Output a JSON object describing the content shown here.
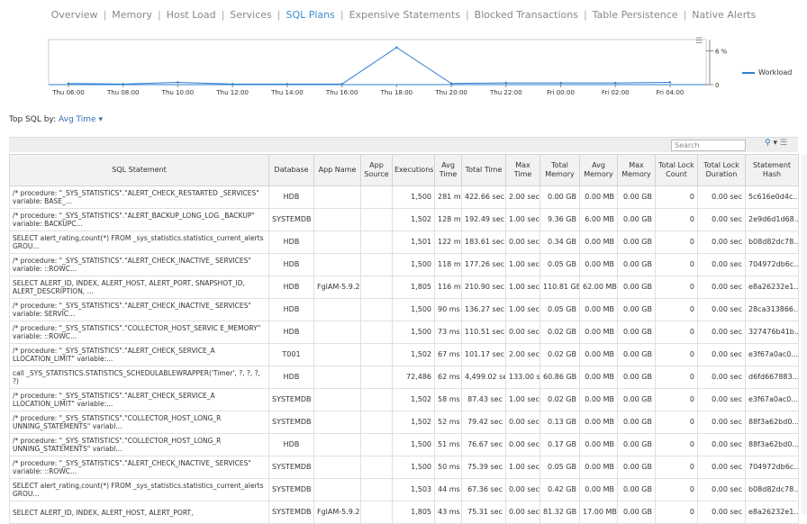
{
  "nav": {
    "tabs": [
      "Overview",
      "Memory",
      "Host Load",
      "Services",
      "SQL Plans",
      "Expensive Statements",
      "Blocked Transactions",
      "Table Persistence",
      "Native Alerts"
    ],
    "active": "SQL Plans"
  },
  "chart_data": {
    "type": "line",
    "x": [
      "Thu 06:00",
      "Thu 08:00",
      "Thu 10:00",
      "Thu 12:00",
      "Thu 14:00",
      "Thu 16:00",
      "Thu 18:00",
      "Thu 20:00",
      "Thu 22:00",
      "Fri 00:00",
      "Fri 02:00",
      "Fri 04:00"
    ],
    "series": [
      {
        "name": "Workload",
        "values": [
          0.2,
          0.1,
          0.4,
          0.1,
          0.1,
          0.1,
          6.6,
          0.2,
          0.3,
          0.3,
          0.3,
          0.4
        ]
      }
    ],
    "y_tick_labels": [
      "0",
      "6 %"
    ],
    "ylim": [
      0,
      8
    ]
  },
  "legend": {
    "label": "Workload",
    "color": "#2f7fd0"
  },
  "topsql": {
    "label": "Top SQL by:",
    "value": "Avg Time"
  },
  "search": {
    "placeholder": "Search"
  },
  "columns": [
    "SQL Statement",
    "Database",
    "App Name",
    "App Source",
    "Executions",
    "Avg Time",
    "Total Time",
    "Max Time",
    "Total Memory",
    "Avg Memory",
    "Max Memory",
    "Total Lock Count",
    "Total Lock Duration",
    "Statement Hash"
  ],
  "rows": [
    [
      "/* procedure: \"_SYS_STATISTICS\".\"ALERT_CHECK_RESTARTED _SERVICES\" variable: BASE_...",
      "HDB",
      "",
      "",
      "1,500",
      "281 ms",
      "422.66 sec",
      "2.00 sec",
      "0.00 GB",
      "0.00 MB",
      "0.00 GB",
      "0",
      "0.00 sec",
      "5c616e0d4c..."
    ],
    [
      "/* procedure: \"_SYS_STATISTICS\".\"ALERT_BACKUP_LONG_LOG _BACKUP\" variable: BACKUPC...",
      "SYSTEMDB",
      "",
      "",
      "1,502",
      "128 ms",
      "192.49 sec",
      "1.00 sec",
      "9.36 GB",
      "6.00 MB",
      "0.00 GB",
      "0",
      "0.00 sec",
      "2e9d6d1d68..."
    ],
    [
      "SELECT alert_rating,count(*) FROM _sys_statistics.statistics_current_alerts GROU...",
      "HDB",
      "",
      "",
      "1,501",
      "122 ms",
      "183.61 sec",
      "0.00 sec",
      "0.34 GB",
      "0.00 MB",
      "0.00 GB",
      "0",
      "0.00 sec",
      "b08d82dc78..."
    ],
    [
      "/* procedure: \"_SYS_STATISTICS\".\"ALERT_CHECK_INACTIVE_ SERVICES\" variable: ::ROWC...",
      "HDB",
      "",
      "",
      "1,500",
      "118 ms",
      "177.26 sec",
      "1.00 sec",
      "0.05 GB",
      "0.00 MB",
      "0.00 GB",
      "0",
      "0.00 sec",
      "704972db6c..."
    ],
    [
      "SELECT ALERT_ID, INDEX, ALERT_HOST, ALERT_PORT, SNAPSHOT_ID, ALERT_DESCRIPTION, ...",
      "HDB",
      "FglAM-5.9.2",
      "",
      "1,805",
      "116 ms",
      "210.90 sec",
      "1.00 sec",
      "110.81 GB",
      "62.00 MB",
      "0.00 GB",
      "0",
      "0.00 sec",
      "e8a26232e1..."
    ],
    [
      "/* procedure: \"_SYS_STATISTICS\".\"ALERT_CHECK_INACTIVE_ SERVICES\" variable: SERVIC...",
      "HDB",
      "",
      "",
      "1,500",
      "90 ms",
      "136.27 sec",
      "1.00 sec",
      "0.05 GB",
      "0.00 MB",
      "0.00 GB",
      "0",
      "0.00 sec",
      "28ca313866..."
    ],
    [
      "/* procedure: \"_SYS_STATISTICS\".\"COLLECTOR_HOST_SERVIC E_MEMORY\" variable: ::ROWC...",
      "HDB",
      "",
      "",
      "1,500",
      "73 ms",
      "110.51 sec",
      "0.00 sec",
      "0.02 GB",
      "0.00 MB",
      "0.00 GB",
      "0",
      "0.00 sec",
      "327476b41b..."
    ],
    [
      "/* procedure: \"_SYS_STATISTICS\".\"ALERT_CHECK_SERVICE_A LLOCATION_LIMIT\" variable:...",
      "T001",
      "",
      "",
      "1,502",
      "67 ms",
      "101.17 sec",
      "2.00 sec",
      "0.02 GB",
      "0.00 MB",
      "0.00 GB",
      "0",
      "0.00 sec",
      "e3f67a0ac0..."
    ],
    [
      "call _SYS_STATISTICS.STATISTICS_SCHEDULABLEWRAPPER('Timer', ?, ?, ?, ?)",
      "HDB",
      "",
      "",
      "72,486",
      "62 ms",
      "4,499.02 sec",
      "133.00 sec",
      "60.86 GB",
      "0.00 MB",
      "0.00 GB",
      "0",
      "0.00 sec",
      "d6fd667883..."
    ],
    [
      "/* procedure: \"_SYS_STATISTICS\".\"ALERT_CHECK_SERVICE_A LLOCATION_LIMIT\" variable:...",
      "SYSTEMDB",
      "",
      "",
      "1,502",
      "58 ms",
      "87.43 sec",
      "1.00 sec",
      "0.02 GB",
      "0.00 MB",
      "0.00 GB",
      "0",
      "0.00 sec",
      "e3f67a0ac0..."
    ],
    [
      "/* procedure: \"_SYS_STATISTICS\".\"COLLECTOR_HOST_LONG_R UNNING_STATEMENTS\" variabl...",
      "SYSTEMDB",
      "",
      "",
      "1,502",
      "52 ms",
      "79.42 sec",
      "0.00 sec",
      "0.13 GB",
      "0.00 MB",
      "0.00 GB",
      "0",
      "0.00 sec",
      "88f3a62bd0..."
    ],
    [
      "/* procedure: \"_SYS_STATISTICS\".\"COLLECTOR_HOST_LONG_R UNNING_STATEMENTS\" variabl...",
      "HDB",
      "",
      "",
      "1,500",
      "51 ms",
      "76.67 sec",
      "0.00 sec",
      "0.17 GB",
      "0.00 MB",
      "0.00 GB",
      "0",
      "0.00 sec",
      "88f3a62bd0..."
    ],
    [
      "/* procedure: \"_SYS_STATISTICS\".\"ALERT_CHECK_INACTIVE_ SERVICES\" variable: ::ROWC...",
      "SYSTEMDB",
      "",
      "",
      "1,500",
      "50 ms",
      "75.39 sec",
      "1.00 sec",
      "0.05 GB",
      "0.00 MB",
      "0.00 GB",
      "0",
      "0.00 sec",
      "704972db6c..."
    ],
    [
      "SELECT alert_rating,count(*) FROM _sys_statistics.statistics_current_alerts GROU...",
      "SYSTEMDB",
      "",
      "",
      "1,503",
      "44 ms",
      "67.36 sec",
      "0.00 sec",
      "0.42 GB",
      "0.00 MB",
      "0.00 GB",
      "0",
      "0.00 sec",
      "b08d82dc78..."
    ],
    [
      "SELECT ALERT_ID, INDEX, ALERT_HOST, ALERT_PORT,",
      "SYSTEMDB",
      "FglAM-5.9.2",
      "",
      "1,805",
      "43 ms",
      "75.31 sec",
      "0.00 sec",
      "81.32 GB",
      "17.00 MB",
      "0.00 GB",
      "0",
      "0.00 sec",
      "e8a26232e1..."
    ]
  ]
}
